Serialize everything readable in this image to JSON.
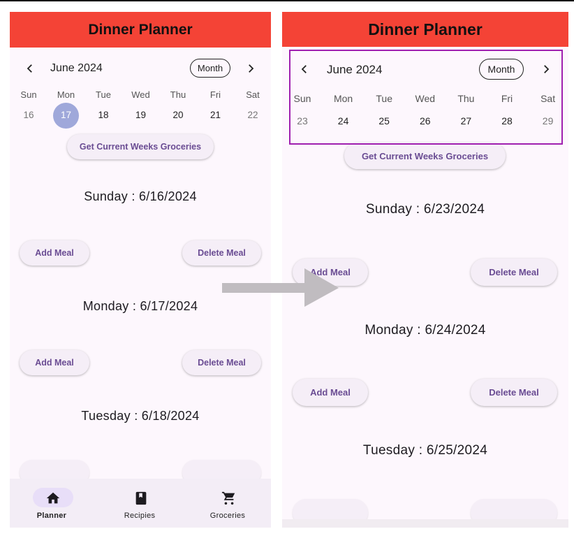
{
  "app": {
    "title": "Dinner Planner"
  },
  "left": {
    "calendar": {
      "month_title": "June 2024",
      "format_button": "Month",
      "weekdays": [
        "Sun",
        "Mon",
        "Tue",
        "Wed",
        "Thu",
        "Fri",
        "Sat"
      ],
      "days": [
        "16",
        "17",
        "18",
        "19",
        "20",
        "21",
        "22"
      ],
      "selected_day": "17"
    },
    "groceries_button": "Get Current Weeks Groceries",
    "day_sections": [
      {
        "label": "Sunday : 6/16/2024",
        "add": "Add Meal",
        "delete": "Delete Meal"
      },
      {
        "label": "Monday : 6/17/2024",
        "add": "Add Meal",
        "delete": "Delete Meal"
      },
      {
        "label": "Tuesday : 6/18/2024"
      }
    ]
  },
  "right": {
    "calendar": {
      "month_title": "June 2024",
      "format_button": "Month",
      "weekdays": [
        "Sun",
        "Mon",
        "Tue",
        "Wed",
        "Thu",
        "Fri",
        "Sat"
      ],
      "days": [
        "23",
        "24",
        "25",
        "26",
        "27",
        "28",
        "29"
      ]
    },
    "groceries_button": "Get Current Weeks Groceries",
    "day_sections": [
      {
        "label": "Sunday : 6/23/2024",
        "add": "Add Meal",
        "delete": "Delete Meal"
      },
      {
        "label": "Monday : 6/24/2024",
        "add": "Add Meal",
        "delete": "Delete Meal"
      },
      {
        "label": "Tuesday : 6/25/2024"
      }
    ]
  },
  "bottom_nav": [
    {
      "label": "Planner",
      "icon": "home-icon",
      "active": true
    },
    {
      "label": "Recipies",
      "icon": "book-icon",
      "active": false
    },
    {
      "label": "Groceries",
      "icon": "cart-icon",
      "active": false
    }
  ],
  "colors": {
    "app_bar": "#f44336",
    "background": "#fdf7fd",
    "selected_day": "#9fa8da",
    "button_text": "#6a4c93",
    "highlight_box": "#a020b0",
    "arrow": "#c0bcc0"
  }
}
